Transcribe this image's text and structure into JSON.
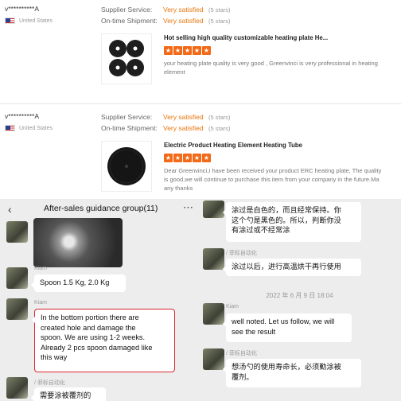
{
  "reviews": [
    {
      "reviewer": "v**********A",
      "country": "United States",
      "supplier_service_label": "Supplier Service:",
      "supplier_service_value": "Very satisfied",
      "supplier_service_stars": "(5 stars)",
      "shipment_label": "On-time Shipment:",
      "shipment_value": "Very satisfied",
      "shipment_stars": "(5 stars)",
      "product_title": "Hot selling high quality customizable heating plate He...",
      "rating": 5,
      "text_line1": "your heating plate quality is very good , Greenvinci is very professional in heating",
      "text_line2": "element"
    },
    {
      "reviewer": "v**********A",
      "country": "United States",
      "supplier_service_label": "Supplier Service:",
      "supplier_service_value": "Very satisfied",
      "supplier_service_stars": "(5 stars)",
      "shipment_label": "On-time Shipment:",
      "shipment_value": "Very satisfied",
      "shipment_stars": "(5 stars)",
      "product_title": "Electric Product Heating Element Heating Tube",
      "rating": 5,
      "text_line1": "Dear Greenvinci,I have been received your product ERC heating plate,  The quality",
      "text_line2": "is good,we will continue to purchase this item from your company in the future.Ma",
      "text_line3": "any thanks"
    }
  ],
  "chat_left": {
    "title": "After-sales guidance group",
    "member_count": "(11)",
    "back_icon": "chevron-left-icon",
    "more_icon": "more-icon",
    "messages": [
      {
        "sender": "Kiam",
        "text": "Spoon 1.5 Kg, 2.0 Kg"
      },
      {
        "sender": "Kiam",
        "text_lines": [
          "In the bottom portion there are",
          "created hole and damage the",
          "spoon. We are using  1-2 weeks.",
          "Already 2 pcs spoon damaged like",
          " this way"
        ]
      },
      {
        "sender": "/ 菲标自动化",
        "text": "需要涂被覆剂的"
      }
    ]
  },
  "chat_right": {
    "messages": [
      {
        "text_lines": [
          "涂过是白色的，而且经常保持。你",
          "这个勺是黑色的。所以，判断你没",
          "有涂过或不经常涂"
        ]
      },
      {
        "sender": "/ 菲标自动化",
        "text": "涂过以后，进行高温烘干再行使用"
      },
      {
        "sender": "Kiam",
        "text_lines": [
          "well noted. Let us follow, we will",
          "see the result"
        ]
      },
      {
        "sender": "/ 菲标自动化",
        "text_lines": [
          "想汤勺的使用寿命长，必须勤涂被",
          "覆剂。"
        ]
      }
    ],
    "timestamp": "2022 年 6 月 9 日  18:04"
  }
}
